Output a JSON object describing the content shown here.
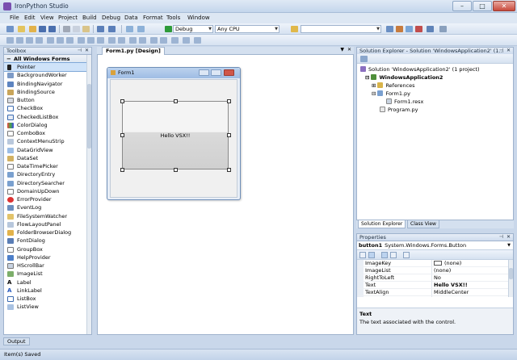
{
  "window": {
    "title": "IronPython Studio"
  },
  "menu": [
    "File",
    "Edit",
    "View",
    "Project",
    "Build",
    "Debug",
    "Data",
    "Format",
    "Tools",
    "Window"
  ],
  "toolbar": {
    "config": "Debug",
    "platform": "Any CPU",
    "find_combo": ""
  },
  "toolbox": {
    "title": "Toolbox",
    "category": "All Windows Forms",
    "items": [
      "Pointer",
      "BackgroundWorker",
      "BindingNavigator",
      "BindingSource",
      "Button",
      "CheckBox",
      "CheckedListBox",
      "ColorDialog",
      "ComboBox",
      "ContextMenuStrip",
      "DataGridView",
      "DataSet",
      "DateTimePicker",
      "DirectoryEntry",
      "DirectorySearcher",
      "DomainUpDown",
      "ErrorProvider",
      "EventLog",
      "FileSystemWatcher",
      "FlowLayoutPanel",
      "FolderBrowserDialog",
      "FontDialog",
      "GroupBox",
      "HelpProvider",
      "HScrollBar",
      "ImageList",
      "Label",
      "LinkLabel",
      "ListBox",
      "ListView"
    ]
  },
  "designer": {
    "tab": "Form1.py [Design]",
    "form_title": "Form1",
    "button_text": "Hello VSX!!"
  },
  "solution_explorer": {
    "title": "Solution Explorer - Solution 'WindowsApplication2' (1...",
    "solution": "Solution 'WindowsApplication2' (1 project)",
    "project": "WindowsApplication2",
    "references": "References",
    "form_py": "Form1.py",
    "form_resx": "Form1.resx",
    "program": "Program.py",
    "tab_solution": "Solution Explorer",
    "tab_class": "Class View"
  },
  "properties": {
    "title": "Properties",
    "object_name": "button1",
    "object_type": "System.Windows.Forms.Button",
    "rows": [
      {
        "name": "ImageKey",
        "value": "(none)"
      },
      {
        "name": "ImageList",
        "value": "(none)"
      },
      {
        "name": "RightToLeft",
        "value": "No"
      },
      {
        "name": "Text",
        "value": "Hello VSX!!"
      },
      {
        "name": "TextAlign",
        "value": "MiddleCenter"
      }
    ],
    "desc_name": "Text",
    "desc_text": "The text associated with the control."
  },
  "output": {
    "tab": "Output"
  },
  "status": {
    "text": "Item(s) Saved"
  }
}
